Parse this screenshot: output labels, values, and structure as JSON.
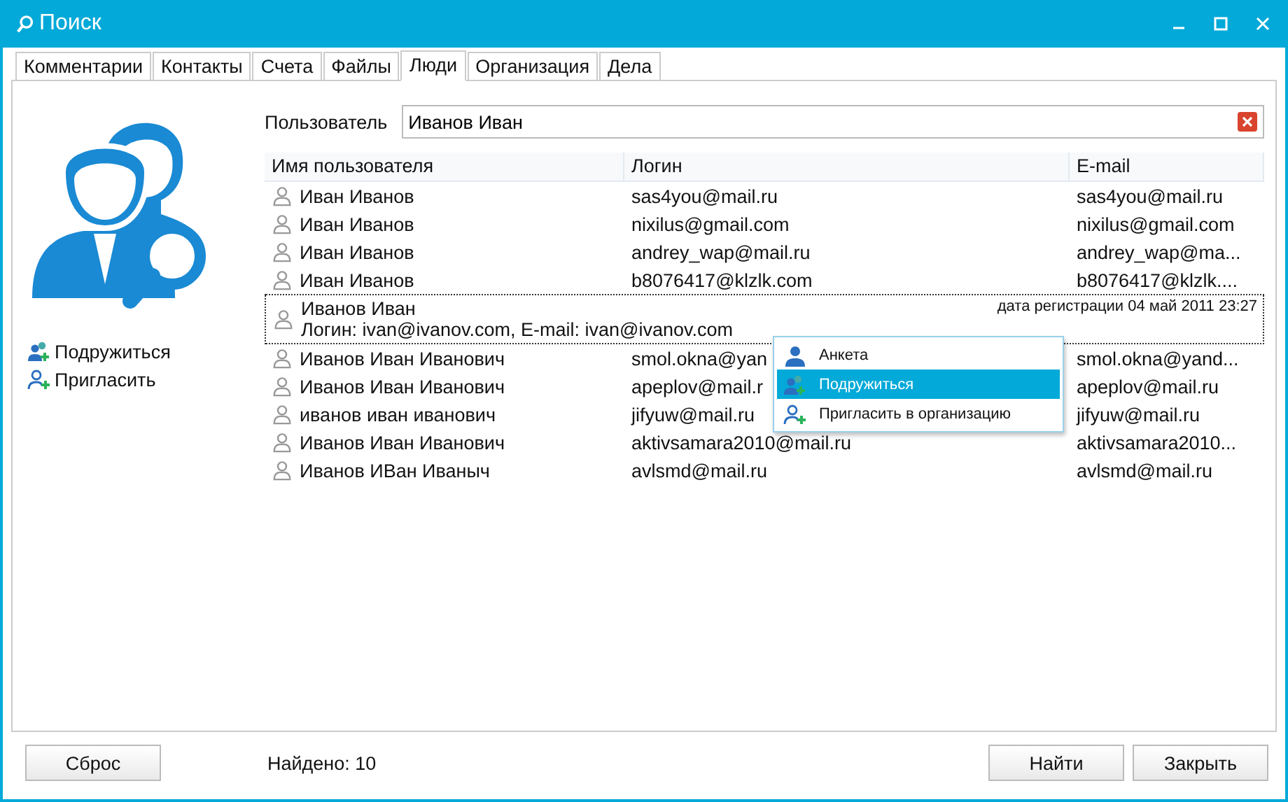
{
  "window": {
    "title": "Поиск"
  },
  "tabs": [
    {
      "label": "Комментарии",
      "selected": false
    },
    {
      "label": "Контакты",
      "selected": false
    },
    {
      "label": "Счета",
      "selected": false
    },
    {
      "label": "Файлы",
      "selected": false
    },
    {
      "label": "Люди",
      "selected": true
    },
    {
      "label": "Организация",
      "selected": false
    },
    {
      "label": "Дела",
      "selected": false
    }
  ],
  "actions": [
    {
      "label": "Подружиться",
      "kind": "friend"
    },
    {
      "label": "Пригласить",
      "kind": "invite"
    }
  ],
  "search": {
    "label": "Пользователь",
    "value": "Иванов Иван"
  },
  "table": {
    "columns": [
      "Имя пользователя",
      "Логин",
      "E-mail"
    ],
    "rows": [
      {
        "kind": "user",
        "name": "Иван Иванов",
        "login": "sas4you@mail.ru",
        "email": "sas4you@mail.ru"
      },
      {
        "kind": "user",
        "name": "Иван Иванов",
        "login": "nixilus@gmail.com",
        "email": "nixilus@gmail.com"
      },
      {
        "kind": "user",
        "name": "Иван Иванов",
        "login": "andrey_wap@mail.ru",
        "email": "andrey_wap@ma..."
      },
      {
        "kind": "user",
        "name": "Иван Иванов",
        "login": "b8076417@klzlk.com",
        "email": "b8076417@klzlk...."
      },
      {
        "kind": "expanded",
        "name": "Иванов Иван",
        "details": "Логин: ivan@ivanov.com, E-mail: ivan@ivanov.com",
        "registered": "дата регистрации 04 май 2011 23:27"
      },
      {
        "kind": "user",
        "name": "Иванов Иван Иванович",
        "login": "smol.okna@yan",
        "email": "smol.okna@yand..."
      },
      {
        "kind": "user",
        "name": "Иванов Иван Иванович",
        "login": "apeplov@mail.r",
        "email": "apeplov@mail.ru"
      },
      {
        "kind": "user",
        "name": "иванов иван иванович",
        "login": "jifyuw@mail.ru",
        "email": "jifyuw@mail.ru"
      },
      {
        "kind": "user",
        "name": "Иванов Иван Иванович",
        "login": "aktivsamara2010@mail.ru",
        "email": "aktivsamara2010..."
      },
      {
        "kind": "user",
        "name": "Иванов ИВан Иваныч",
        "login": "avlsmd@mail.ru",
        "email": "avlsmd@mail.ru"
      }
    ]
  },
  "context_menu": [
    {
      "label": "Анкета",
      "kind": "profile",
      "selected": false
    },
    {
      "label": "Подружиться",
      "kind": "friend",
      "selected": true
    },
    {
      "label": "Пригласить в организацию",
      "kind": "invite",
      "selected": false
    }
  ],
  "status": "Найдено:  10",
  "buttons": {
    "reset": "Сброс",
    "find": "Найти",
    "close": "Закрыть"
  }
}
